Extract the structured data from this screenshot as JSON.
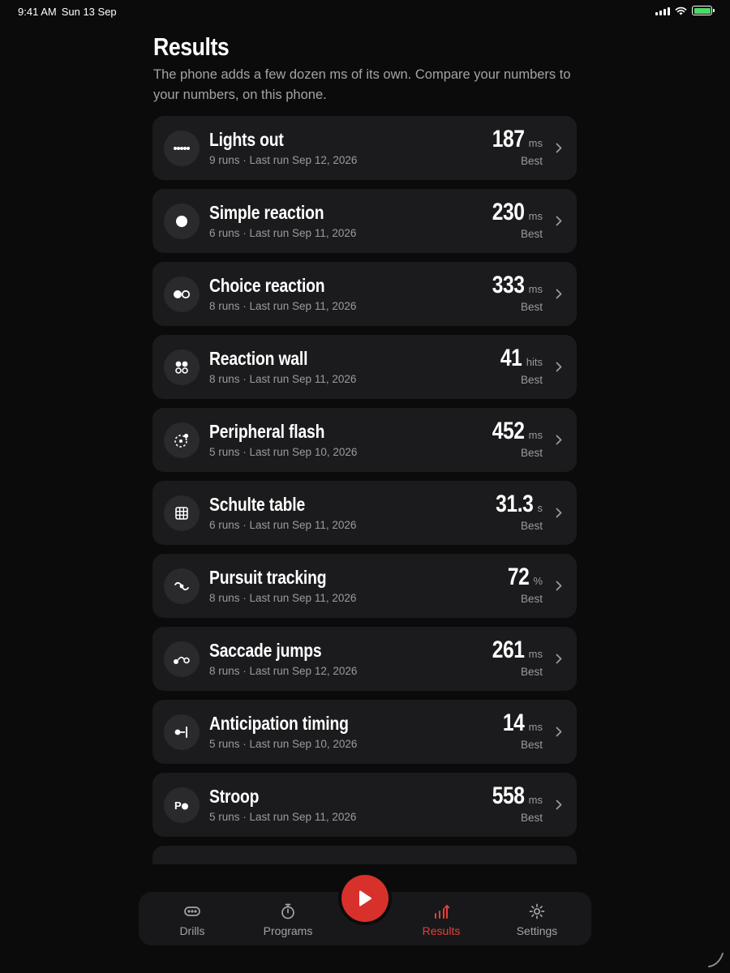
{
  "status_bar": {
    "time": "9:41 AM",
    "date": "Sun 13 Sep"
  },
  "header": {
    "title": "Results",
    "subtitle": "The phone adds a few dozen ms of its own. Compare your numbers to your numbers, on this phone."
  },
  "drills": [
    {
      "name": "Lights out",
      "meta": "9 runs · Last run Sep 12, 2026",
      "value": "187",
      "unit": "ms",
      "best_label": "Best",
      "icon": "lights-out-icon"
    },
    {
      "name": "Simple reaction",
      "meta": "6 runs · Last run Sep 11, 2026",
      "value": "230",
      "unit": "ms",
      "best_label": "Best",
      "icon": "simple-reaction-icon"
    },
    {
      "name": "Choice reaction",
      "meta": "8 runs · Last run Sep 11, 2026",
      "value": "333",
      "unit": "ms",
      "best_label": "Best",
      "icon": "choice-reaction-icon"
    },
    {
      "name": "Reaction wall",
      "meta": "8 runs · Last run Sep 11, 2026",
      "value": "41",
      "unit": "hits",
      "best_label": "Best",
      "icon": "reaction-wall-icon"
    },
    {
      "name": "Peripheral flash",
      "meta": "5 runs · Last run Sep 10, 2026",
      "value": "452",
      "unit": "ms",
      "best_label": "Best",
      "icon": "peripheral-flash-icon"
    },
    {
      "name": "Schulte table",
      "meta": "6 runs · Last run Sep 11, 2026",
      "value": "31.3",
      "unit": "s",
      "best_label": "Best",
      "icon": "grid-icon"
    },
    {
      "name": "Pursuit tracking",
      "meta": "8 runs · Last run Sep 11, 2026",
      "value": "72",
      "unit": "%",
      "best_label": "Best",
      "icon": "pursuit-tracking-icon"
    },
    {
      "name": "Saccade jumps",
      "meta": "8 runs · Last run Sep 12, 2026",
      "value": "261",
      "unit": "ms",
      "best_label": "Best",
      "icon": "saccade-jumps-icon"
    },
    {
      "name": "Anticipation timing",
      "meta": "5 runs · Last run Sep 10, 2026",
      "value": "14",
      "unit": "ms",
      "best_label": "Best",
      "icon": "anticipation-timing-icon"
    },
    {
      "name": "Stroop",
      "meta": "5 runs · Last run Sep 11, 2026",
      "value": "558",
      "unit": "ms",
      "best_label": "Best",
      "icon": "stroop-icon"
    }
  ],
  "tabbar": {
    "drills": "Drills",
    "programs": "Programs",
    "results": "Results",
    "settings": "Settings",
    "active": "results"
  },
  "colors": {
    "accent": "#e5403a",
    "play_button": "#d8312b",
    "card": "#1b1b1d",
    "background": "#0b0b0c"
  }
}
